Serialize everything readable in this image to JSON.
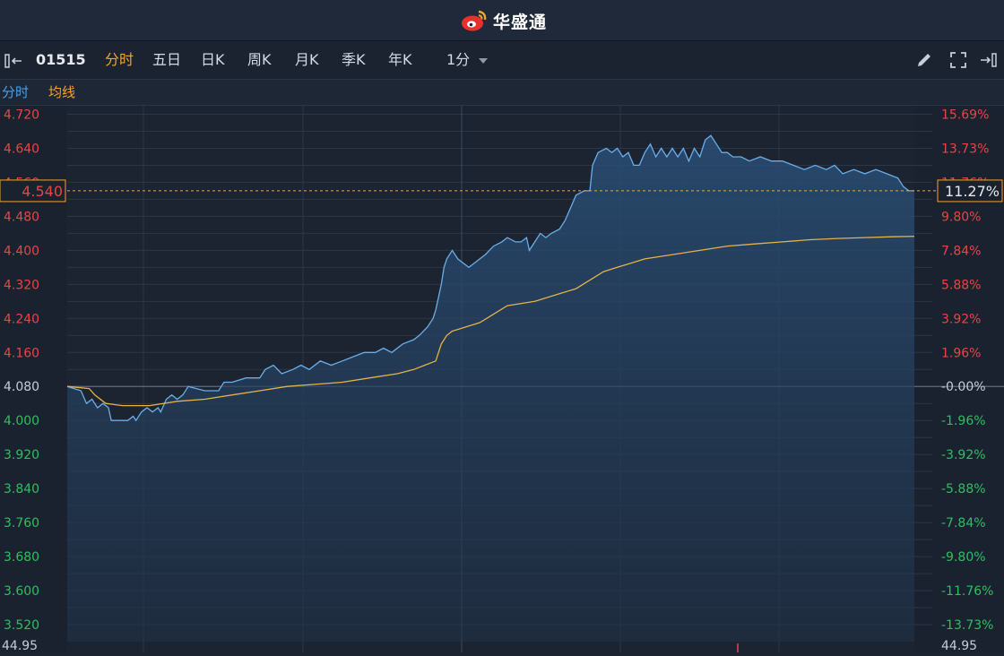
{
  "app": {
    "brand": "华盛通"
  },
  "toolbar": {
    "stock_code": "01515",
    "tabs": [
      {
        "label": "分时",
        "active": true
      },
      {
        "label": "五日",
        "active": false
      },
      {
        "label": "日K",
        "active": false
      },
      {
        "label": "周K",
        "active": false
      },
      {
        "label": "月K",
        "active": false
      },
      {
        "label": "季K",
        "active": false
      },
      {
        "label": "年K",
        "active": false
      }
    ],
    "period": {
      "label": "1分"
    },
    "icons": [
      "collapse-left-icon",
      "pencil-icon",
      "fullscreen-icon",
      "expand-right-icon"
    ]
  },
  "legend": {
    "items": [
      {
        "label": "分时",
        "color": "#4a9fe8"
      },
      {
        "label": "均线",
        "color": "#f0a432"
      }
    ]
  },
  "colors": {
    "background": "#1c2432",
    "grid": "#2b3647",
    "price_line": "#6aaeea",
    "avg_line": "#e3b34a",
    "up": "#e84545",
    "down": "#2fbf5f",
    "neutral": "#c7cdd6",
    "marker": "#f0a432"
  },
  "chart_data": {
    "type": "line",
    "x_points": 241,
    "base_price": 4.08,
    "ylim": [
      3.48,
      4.74
    ],
    "y_ticks_left": [
      "4.720",
      "4.640",
      "4.560",
      "4.480",
      "4.400",
      "4.320",
      "4.240",
      "4.160",
      "4.080",
      "4.000",
      "3.920",
      "3.840",
      "3.760",
      "3.680",
      "3.600",
      "3.520"
    ],
    "y_ticks_right": [
      "15.69%",
      "13.73%",
      "11.76%",
      "9.80%",
      "7.84%",
      "5.88%",
      "3.92%",
      "1.96%",
      "-0.00%",
      "-1.96%",
      "-3.92%",
      "-5.88%",
      "-7.84%",
      "-9.80%",
      "-11.76%",
      "-13.73%"
    ],
    "current_price_label": "4.540",
    "current_pct_label": "11.27%",
    "bottom_left_label": "44.95",
    "bottom_right_label": "44.95",
    "series": [
      {
        "name": "分时",
        "keypoints": [
          [
            0,
            4.08
          ],
          [
            5,
            4.07
          ],
          [
            7,
            4.04
          ],
          [
            9,
            4.05
          ],
          [
            11,
            4.03
          ],
          [
            13,
            4.04
          ],
          [
            15,
            4.03
          ],
          [
            16,
            4.0
          ],
          [
            22,
            4.0
          ],
          [
            24,
            4.01
          ],
          [
            25,
            4.0
          ],
          [
            27,
            4.02
          ],
          [
            29,
            4.03
          ],
          [
            31,
            4.02
          ],
          [
            33,
            4.03
          ],
          [
            34,
            4.02
          ],
          [
            36,
            4.05
          ],
          [
            38,
            4.06
          ],
          [
            40,
            4.05
          ],
          [
            42,
            4.06
          ],
          [
            44,
            4.08
          ],
          [
            50,
            4.07
          ],
          [
            55,
            4.07
          ],
          [
            57,
            4.09
          ],
          [
            60,
            4.09
          ],
          [
            65,
            4.1
          ],
          [
            70,
            4.1
          ],
          [
            72,
            4.12
          ],
          [
            75,
            4.13
          ],
          [
            78,
            4.11
          ],
          [
            82,
            4.12
          ],
          [
            85,
            4.13
          ],
          [
            88,
            4.12
          ],
          [
            92,
            4.14
          ],
          [
            96,
            4.13
          ],
          [
            100,
            4.14
          ],
          [
            104,
            4.15
          ],
          [
            108,
            4.16
          ],
          [
            112,
            4.16
          ],
          [
            115,
            4.17
          ],
          [
            118,
            4.16
          ],
          [
            122,
            4.18
          ],
          [
            126,
            4.19
          ],
          [
            128,
            4.2
          ],
          [
            131,
            4.22
          ],
          [
            133,
            4.24
          ],
          [
            134,
            4.26
          ],
          [
            136,
            4.32
          ],
          [
            137,
            4.36
          ],
          [
            138,
            4.38
          ],
          [
            140,
            4.4
          ],
          [
            142,
            4.38
          ],
          [
            144,
            4.37
          ],
          [
            146,
            4.36
          ],
          [
            148,
            4.37
          ],
          [
            150,
            4.38
          ],
          [
            152,
            4.39
          ],
          [
            155,
            4.41
          ],
          [
            158,
            4.42
          ],
          [
            160,
            4.43
          ],
          [
            163,
            4.42
          ],
          [
            165,
            4.42
          ],
          [
            167,
            4.43
          ],
          [
            168,
            4.4
          ],
          [
            170,
            4.42
          ],
          [
            172,
            4.44
          ],
          [
            174,
            4.43
          ],
          [
            176,
            4.44
          ],
          [
            179,
            4.45
          ],
          [
            181,
            4.47
          ],
          [
            183,
            4.5
          ],
          [
            185,
            4.53
          ],
          [
            188,
            4.54
          ],
          [
            190,
            4.54
          ],
          [
            191,
            4.6
          ],
          [
            193,
            4.63
          ],
          [
            196,
            4.64
          ],
          [
            198,
            4.63
          ],
          [
            200,
            4.64
          ],
          [
            202,
            4.62
          ],
          [
            204,
            4.63
          ],
          [
            206,
            4.6
          ],
          [
            208,
            4.6
          ],
          [
            210,
            4.63
          ],
          [
            212,
            4.65
          ],
          [
            214,
            4.62
          ],
          [
            216,
            4.64
          ],
          [
            218,
            4.62
          ],
          [
            220,
            4.64
          ],
          [
            222,
            4.62
          ],
          [
            224,
            4.64
          ],
          [
            226,
            4.61
          ],
          [
            228,
            4.64
          ],
          [
            230,
            4.62
          ],
          [
            232,
            4.66
          ],
          [
            234,
            4.67
          ],
          [
            236,
            4.65
          ],
          [
            238,
            4.63
          ],
          [
            240,
            4.63
          ],
          [
            242,
            4.62
          ],
          [
            245,
            4.62
          ],
          [
            248,
            4.61
          ],
          [
            252,
            4.62
          ],
          [
            256,
            4.61
          ],
          [
            260,
            4.61
          ],
          [
            264,
            4.6
          ],
          [
            268,
            4.59
          ],
          [
            272,
            4.6
          ],
          [
            276,
            4.59
          ],
          [
            279,
            4.6
          ],
          [
            282,
            4.58
          ],
          [
            286,
            4.59
          ],
          [
            290,
            4.58
          ],
          [
            294,
            4.59
          ],
          [
            298,
            4.58
          ],
          [
            302,
            4.57
          ],
          [
            304,
            4.55
          ],
          [
            306,
            4.54
          ],
          [
            308,
            4.54
          ]
        ]
      },
      {
        "name": "均线",
        "keypoints": [
          [
            0,
            4.08
          ],
          [
            8,
            4.075
          ],
          [
            10,
            4.06
          ],
          [
            14,
            4.04
          ],
          [
            20,
            4.035
          ],
          [
            30,
            4.035
          ],
          [
            40,
            4.045
          ],
          [
            50,
            4.05
          ],
          [
            60,
            4.06
          ],
          [
            70,
            4.07
          ],
          [
            80,
            4.08
          ],
          [
            90,
            4.085
          ],
          [
            100,
            4.09
          ],
          [
            110,
            4.1
          ],
          [
            120,
            4.11
          ],
          [
            126,
            4.12
          ],
          [
            130,
            4.13
          ],
          [
            134,
            4.14
          ],
          [
            136,
            4.18
          ],
          [
            138,
            4.2
          ],
          [
            140,
            4.21
          ],
          [
            145,
            4.22
          ],
          [
            150,
            4.23
          ],
          [
            155,
            4.25
          ],
          [
            160,
            4.27
          ],
          [
            170,
            4.28
          ],
          [
            180,
            4.3
          ],
          [
            185,
            4.31
          ],
          [
            190,
            4.33
          ],
          [
            195,
            4.35
          ],
          [
            200,
            4.36
          ],
          [
            205,
            4.37
          ],
          [
            210,
            4.38
          ],
          [
            220,
            4.39
          ],
          [
            230,
            4.4
          ],
          [
            240,
            4.41
          ],
          [
            250,
            4.415
          ],
          [
            260,
            4.42
          ],
          [
            270,
            4.425
          ],
          [
            280,
            4.428
          ],
          [
            290,
            4.43
          ],
          [
            300,
            4.432
          ],
          [
            308,
            4.433
          ]
        ]
      }
    ]
  }
}
